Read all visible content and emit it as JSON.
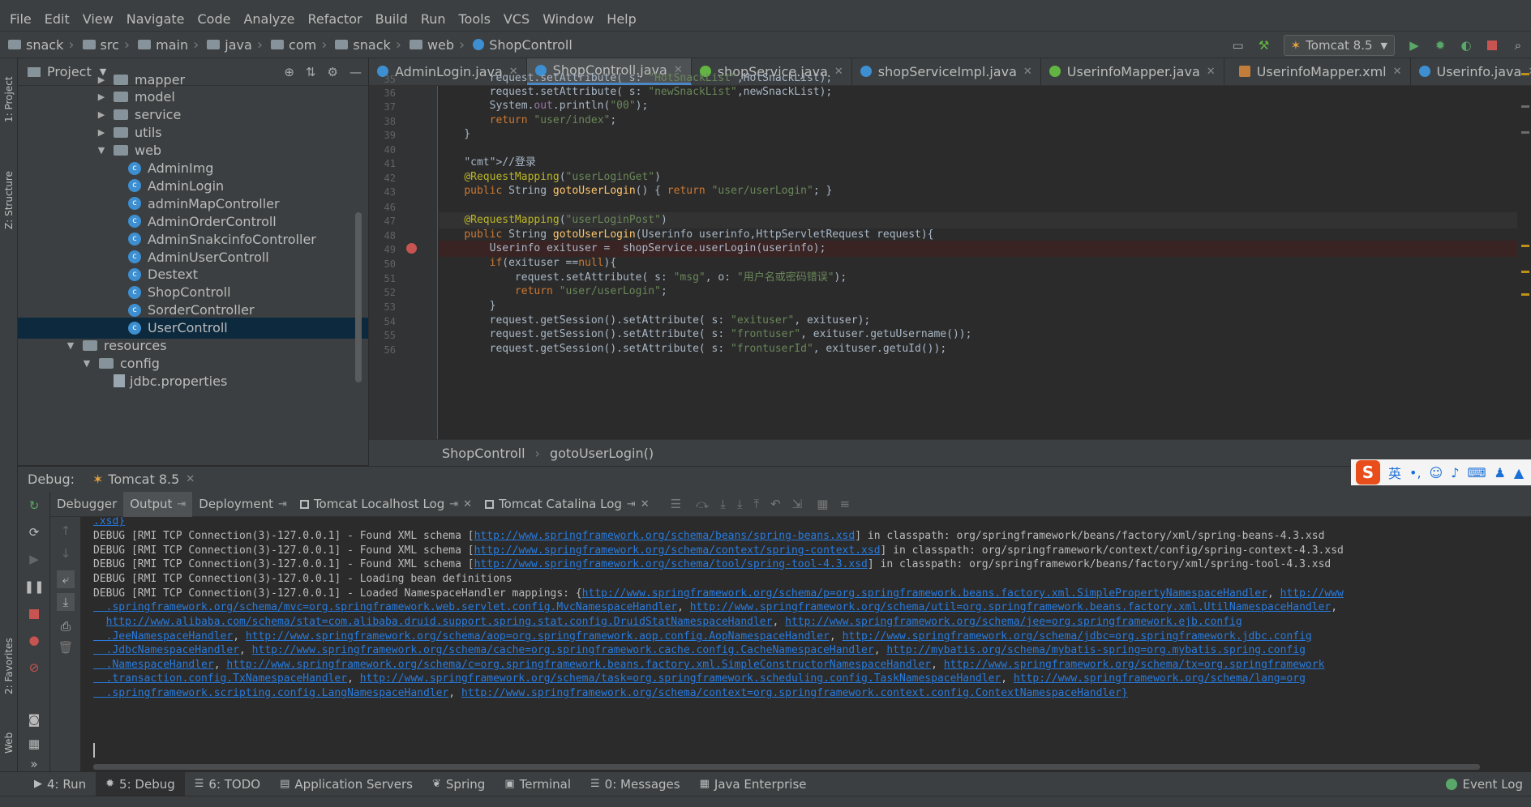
{
  "menu": [
    "File",
    "Edit",
    "View",
    "Navigate",
    "Code",
    "Analyze",
    "Refactor",
    "Build",
    "Run",
    "Tools",
    "VCS",
    "Window",
    "Help"
  ],
  "breadcrumb": [
    "snack",
    "src",
    "main",
    "java",
    "com",
    "snack",
    "web",
    "ShopControll"
  ],
  "run_config": "Tomcat 8.5",
  "side_tabs": {
    "project": "1: Project",
    "structure": "Z: Structure",
    "favorites": "2: Favorites",
    "web": "Web"
  },
  "project": {
    "title": "Project",
    "tree": [
      {
        "label": "mapper",
        "kind": "folder",
        "expanded": false
      },
      {
        "label": "model",
        "kind": "folder",
        "expanded": false
      },
      {
        "label": "service",
        "kind": "folder",
        "expanded": false
      },
      {
        "label": "utils",
        "kind": "folder",
        "expanded": false
      },
      {
        "label": "web",
        "kind": "folder",
        "expanded": true
      },
      {
        "label": "AdminImg",
        "kind": "class"
      },
      {
        "label": "AdminLogin",
        "kind": "class"
      },
      {
        "label": "adminMapController",
        "kind": "class"
      },
      {
        "label": "AdminOrderControll",
        "kind": "class"
      },
      {
        "label": "AdminSnakcinfoController",
        "kind": "class"
      },
      {
        "label": "AdminUserControll",
        "kind": "class"
      },
      {
        "label": "Destext",
        "kind": "class"
      },
      {
        "label": "ShopControll",
        "kind": "class"
      },
      {
        "label": "SorderController",
        "kind": "class"
      },
      {
        "label": "UserControll",
        "kind": "class",
        "selected": true
      },
      {
        "label": "resources",
        "kind": "folder",
        "expanded": true
      },
      {
        "label": "config",
        "kind": "folder",
        "expanded": true
      },
      {
        "label": "jdbc.properties",
        "kind": "properties"
      }
    ]
  },
  "editor_tabs": [
    {
      "label": "AdminLogin.java",
      "type": "class"
    },
    {
      "label": "ShopControll.java",
      "type": "class",
      "active": true
    },
    {
      "label": "shopService.java",
      "type": "interface"
    },
    {
      "label": "shopServiceImpl.java",
      "type": "class"
    },
    {
      "label": "UserinfoMapper.java",
      "type": "interface"
    },
    {
      "label": "UserinfoMapper.xml",
      "type": "xml"
    },
    {
      "label": "Userinfo.java",
      "type": "class"
    }
  ],
  "code": [
    {
      "n": "35",
      "text": "        request.setAttribute( s: \"HotSnackList\",HotSnackList);"
    },
    {
      "n": "36",
      "text": "        request.setAttribute( s: \"newSnackList\",newSnackList);"
    },
    {
      "n": "37",
      "text": "        System.out.println(\"00\");"
    },
    {
      "n": "38",
      "text": "        return \"user/index\";"
    },
    {
      "n": "39",
      "text": "    }"
    },
    {
      "n": "40",
      "text": ""
    },
    {
      "n": "41",
      "text": "    //登录"
    },
    {
      "n": "42",
      "text": "    @RequestMapping(\"userLoginGet\")"
    },
    {
      "n": "43",
      "text": "    public String gotoUserLogin() { return \"user/userLogin\"; }"
    },
    {
      "n": "46",
      "text": ""
    },
    {
      "n": "47",
      "text": "    @RequestMapping(\"userLoginPost\")"
    },
    {
      "n": "48",
      "text": "    public String gotoUserLogin(Userinfo userinfo,HttpServletRequest request){"
    },
    {
      "n": "49",
      "text": "        Userinfo exituser =  shopService.userLogin(userinfo);"
    },
    {
      "n": "50",
      "text": "        if(exituser ==null){"
    },
    {
      "n": "51",
      "text": "            request.setAttribute( s: \"msg\", o: \"用户名或密码错误\");"
    },
    {
      "n": "52",
      "text": "            return \"user/userLogin\";"
    },
    {
      "n": "53",
      "text": "        }"
    },
    {
      "n": "54",
      "text": "        request.getSession().setAttribute( s: \"exituser\", exituser);"
    },
    {
      "n": "55",
      "text": "        request.getSession().setAttribute( s: \"frontuser\", exituser.getuUsername());"
    },
    {
      "n": "56",
      "text": "        request.getSession().setAttribute( s: \"frontuserId\", exituser.getuId());"
    }
  ],
  "editor_crumb": [
    "ShopControll",
    "gotoUserLogin()"
  ],
  "debug": {
    "label": "Debug:",
    "session": "Tomcat 8.5",
    "tabs": [
      "Debugger",
      "Output",
      "Deployment",
      "Tomcat Localhost Log",
      "Tomcat Catalina Log"
    ],
    "active_tab": "Output"
  },
  "ime": {
    "lang": "英"
  },
  "console": [
    ".xsd}",
    "DEBUG [RMI TCP Connection(3)-127.0.0.1] - Found XML schema [http://www.springframework.org/schema/beans/spring-beans.xsd] in classpath: org/springframework/beans/factory/xml/spring-beans-4.3.xsd",
    "DEBUG [RMI TCP Connection(3)-127.0.0.1] - Found XML schema [http://www.springframework.org/schema/context/spring-context.xsd] in classpath: org/springframework/context/config/spring-context-4.3.xsd",
    "DEBUG [RMI TCP Connection(3)-127.0.0.1] - Found XML schema [http://www.springframework.org/schema/tool/spring-tool-4.3.xsd] in classpath: org/springframework/beans/factory/xml/spring-tool-4.3.xsd",
    "DEBUG [RMI TCP Connection(3)-127.0.0.1] - Loading bean definitions",
    "DEBUG [RMI TCP Connection(3)-127.0.0.1] - Loaded NamespaceHandler mappings: {http://www.springframework.org/schema/p=org.springframework.beans.factory.xml.SimplePropertyNamespaceHandler, http://www",
    "  .springframework.org/schema/mvc=org.springframework.web.servlet.config.MvcNamespaceHandler, http://www.springframework.org/schema/util=org.springframework.beans.factory.xml.UtilNamespaceHandler,",
    "  http://www.alibaba.com/schema/stat=com.alibaba.druid.support.spring.stat.config.DruidStatNamespaceHandler, http://www.springframework.org/schema/jee=org.springframework.ejb.config",
    "  .JeeNamespaceHandler, http://www.springframework.org/schema/aop=org.springframework.aop.config.AopNamespaceHandler, http://www.springframework.org/schema/jdbc=org.springframework.jdbc.config",
    "  .JdbcNamespaceHandler, http://www.springframework.org/schema/cache=org.springframework.cache.config.CacheNamespaceHandler, http://mybatis.org/schema/mybatis-spring=org.mybatis.spring.config",
    "  .NamespaceHandler, http://www.springframework.org/schema/c=org.springframework.beans.factory.xml.SimpleConstructorNamespaceHandler, http://www.springframework.org/schema/tx=org.springframework",
    "  .transaction.config.TxNamespaceHandler, http://www.springframework.org/schema/task=org.springframework.scheduling.config.TaskNamespaceHandler, http://www.springframework.org/schema/lang=org",
    "  .springframework.scripting.config.LangNamespaceHandler, http://www.springframework.org/schema/context=org.springframework.context.config.ContextNamespaceHandler}"
  ],
  "bottom_tabs": [
    {
      "label": "4: Run",
      "icon": "run-icon"
    },
    {
      "label": "5: Debug",
      "icon": "bug-icon",
      "active": true
    },
    {
      "label": "6: TODO",
      "icon": "list-icon"
    },
    {
      "label": "Application Servers",
      "icon": "server-icon"
    },
    {
      "label": "Spring",
      "icon": "leaf-icon"
    },
    {
      "label": "Terminal",
      "icon": "terminal-icon"
    },
    {
      "label": "0: Messages",
      "icon": "messages-icon"
    },
    {
      "label": "Java Enterprise",
      "icon": "enterprise-icon"
    }
  ],
  "event_log": "Event Log",
  "colors": {
    "accent": "#4a88c7",
    "link": "#287bde",
    "breakpoint": "#c75450",
    "selection": "#0d293e"
  }
}
